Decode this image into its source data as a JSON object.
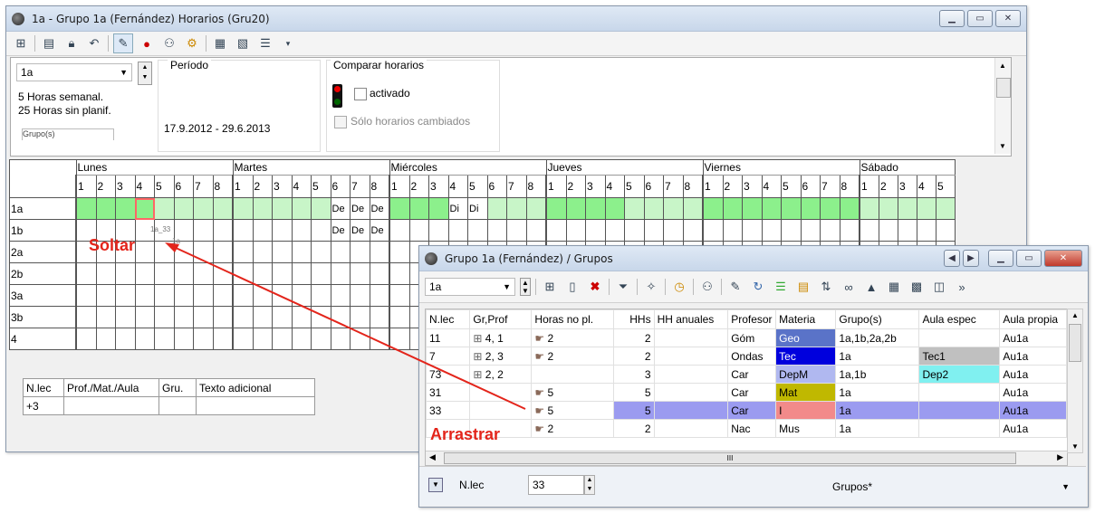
{
  "win1": {
    "title": "1a - Grupo 1a (Fernández)  Horarios  (Gru20)",
    "class_select": "1a",
    "hours_week": "5  Horas semanal.",
    "hours_unplanned": "25  Horas sin planif.",
    "group_tab": "Grupo(s)",
    "period_label": "Período",
    "period_value": "17.9.2012 - 29.6.2013",
    "compare_label": "Comparar horarios",
    "activated_label": "activado",
    "changed_only_label": "Sólo horarios cambiados",
    "days": [
      "Lunes",
      "Martes",
      "Miércoles",
      "Jueves",
      "Viernes",
      "Sábado"
    ],
    "rows": [
      "1a",
      "1b",
      "2a",
      "2b",
      "3a",
      "3b",
      "4"
    ],
    "cell_de": "De",
    "cell_di": "Di",
    "ghost_1": "1a_33",
    "ghost_2": "1a",
    "bottom_headers": [
      "N.lec",
      "Prof./Mat./Aula",
      "Gru.",
      "Texto adicional"
    ],
    "bottom_value": "+3"
  },
  "labels": {
    "soltar": "Soltar",
    "arrastrar": "Arrastrar"
  },
  "win2": {
    "title": "Grupo 1a (Fernández) / Grupos",
    "class_select": "1a",
    "headers": [
      "N.lec",
      "Gr,Prof",
      "Horas no pl.",
      "HHs",
      "HH anuales",
      "Profesor",
      "Materia",
      "Grupo(s)",
      "Aula espec",
      "Aula propia"
    ],
    "rows": [
      {
        "nlec": "11",
        "grprof": "4, 1",
        "horas": "2",
        "hhs": "2",
        "prof": "Góm",
        "mat": "Geo",
        "grupos": "1a,1b,2a,2b",
        "aulaesp": "",
        "aulapro": "Au1a"
      },
      {
        "nlec": "7",
        "grprof": "2, 3",
        "horas": "2",
        "hhs": "2",
        "prof": "Ondas",
        "mat": "Tec",
        "grupos": "1a",
        "aulaesp": "Tec1",
        "aulapro": "Au1a"
      },
      {
        "nlec": "73",
        "grprof": "2, 2",
        "horas": "",
        "hhs": "3",
        "prof": "Car",
        "mat": "DepM",
        "grupos": "1a,1b",
        "aulaesp": "Dep2",
        "aulapro": "Au1a"
      },
      {
        "nlec": "31",
        "grprof": "",
        "horas": "5",
        "hhs": "5",
        "prof": "Car",
        "mat": "Mat",
        "grupos": "1a",
        "aulaesp": "",
        "aulapro": "Au1a"
      },
      {
        "nlec": "33",
        "grprof": "",
        "horas": "5",
        "hhs": "5",
        "prof": "Car",
        "mat": "I",
        "grupos": "1a",
        "aulaesp": "",
        "aulapro": "Au1a"
      },
      {
        "nlec": "",
        "grprof": "",
        "horas": "2",
        "hhs": "2",
        "prof": "Nac",
        "mat": "Mus",
        "grupos": "1a",
        "aulaesp": "",
        "aulapro": "Au1a"
      }
    ],
    "scroll_mark": "III",
    "nlec_label": "N.lec",
    "nlec_value": "33",
    "groups_select": "Grupos*"
  },
  "colors": {
    "geo": "#5a73c8",
    "tec": "#0000dd",
    "depm": "#b0b8f0",
    "mat": "#c0b800",
    "i": "#f28a8a",
    "mus": "#ffffff",
    "tec1": "#c0c0c0",
    "dep2": "#80f0f0",
    "selrow": "#9b9bf0",
    "arrow": "#e3251b"
  }
}
